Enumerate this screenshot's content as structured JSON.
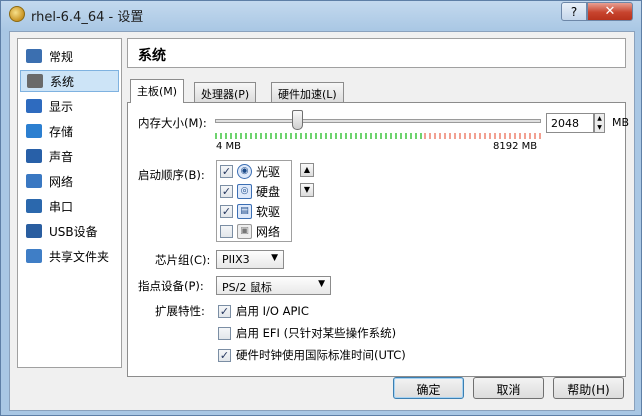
{
  "window": {
    "title": "rhel-6.4_64 - 设置",
    "help_label": "?",
    "close_label": "✕"
  },
  "sidebar": {
    "items": [
      {
        "label": "常规",
        "icon": "general-icon",
        "color": "#3b6fb0"
      },
      {
        "label": "系统",
        "icon": "system-icon",
        "color": "#6a6a6a",
        "selected": true
      },
      {
        "label": "显示",
        "icon": "display-icon",
        "color": "#2e6bbf"
      },
      {
        "label": "存储",
        "icon": "storage-icon",
        "color": "#2c7fd0"
      },
      {
        "label": "声音",
        "icon": "audio-icon",
        "color": "#2860a8"
      },
      {
        "label": "网络",
        "icon": "network-icon",
        "color": "#3a78c2"
      },
      {
        "label": "串口",
        "icon": "serial-port-icon",
        "color": "#2b68ad"
      },
      {
        "label": "USB设备",
        "icon": "usb-icon",
        "color": "#2a5ea0"
      },
      {
        "label": "共享文件夹",
        "icon": "shared-folder-icon",
        "color": "#3f7ec6"
      }
    ]
  },
  "section_title": "系统",
  "tabs": [
    {
      "label": "主板(M)",
      "active": true
    },
    {
      "label": "处理器(P)"
    },
    {
      "label": "硬件加速(L)"
    }
  ],
  "motherboard": {
    "memory_label": "内存大小(M):",
    "memory_value": "2048",
    "memory_unit": "MB",
    "slider_fraction": 0.25,
    "range_min_label": "4  MB",
    "range_max_label": "8192  MB",
    "boot_order_label": "启动顺序(B):",
    "boot_devices": [
      {
        "label": "光驱",
        "checked": true,
        "icon": "optical-drive-icon"
      },
      {
        "label": "硬盘",
        "checked": true,
        "icon": "hard-disk-icon"
      },
      {
        "label": "软驱",
        "checked": true,
        "icon": "floppy-icon"
      },
      {
        "label": "网络",
        "checked": false,
        "icon": "network-boot-icon"
      }
    ],
    "chipset_label": "芯片组(C):",
    "chipset_value": "PIIX3",
    "pointing_label": "指点设备(P):",
    "pointing_value": "PS/2 鼠标",
    "extended_label": "扩展特性:",
    "options": [
      {
        "label": "启用 I/O APIC",
        "checked": true
      },
      {
        "label": "启用 EFI (只针对某些操作系统)",
        "checked": false
      },
      {
        "label": "硬件时钟使用国际标准时间(UTC)",
        "checked": true
      }
    ]
  },
  "buttons": {
    "ok": "确定",
    "cancel": "取消",
    "help": "帮助(H)"
  }
}
